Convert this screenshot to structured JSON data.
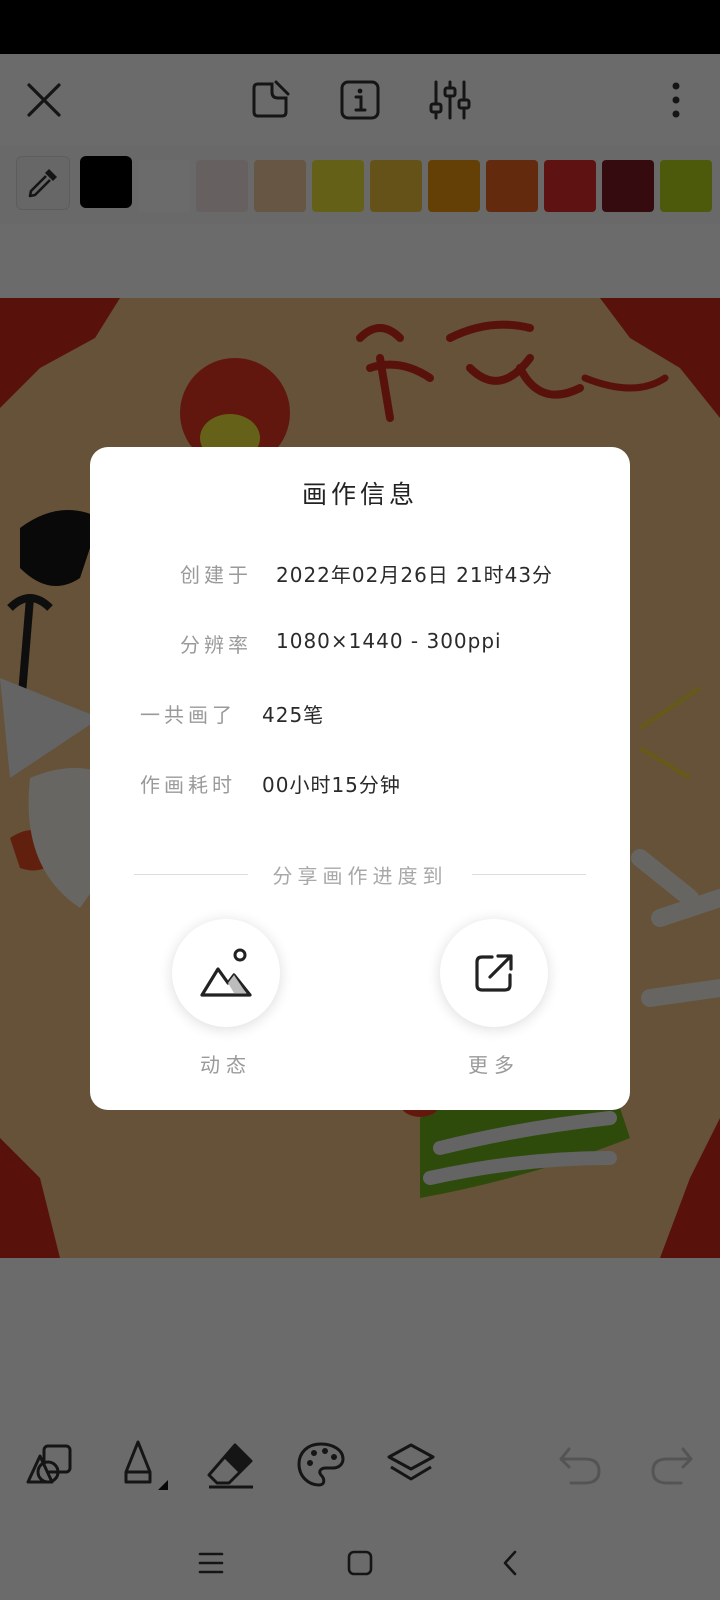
{
  "toolbar": {
    "icons": [
      "close-icon",
      "sticky-note-icon",
      "info-icon",
      "sliders-icon",
      "more-vertical-icon"
    ]
  },
  "palette": {
    "current_color": "#000000",
    "swatches": [
      "#ffffff",
      "#f3e8e4",
      "#f2ce9f",
      "#f1e437",
      "#f0c43c",
      "#f09a0f",
      "#ee6421",
      "#e32b2b",
      "#7e1b26",
      "#b9d61b"
    ]
  },
  "bottom_tools": {
    "icons": [
      "shapes-icon",
      "pencil-icon",
      "eraser-icon",
      "palette-icon",
      "layers-icon",
      "undo-icon",
      "redo-icon"
    ]
  },
  "nav": {
    "icons": [
      "menu-icon",
      "home-icon",
      "back-icon"
    ]
  },
  "dialog": {
    "title": "画作信息",
    "created_label": "创建于",
    "created_value": "2022年02月26日 21时43分",
    "resolution_label": "分辨率",
    "resolution_value": "1080×1440 - 300ppi",
    "strokes_label": "一共画了",
    "strokes_value": "425笔",
    "time_label": "作画耗时",
    "time_value": "00小时15分钟",
    "share_title": "分享画作进度到",
    "share_moments_label": "动态",
    "share_more_label": "更多"
  }
}
